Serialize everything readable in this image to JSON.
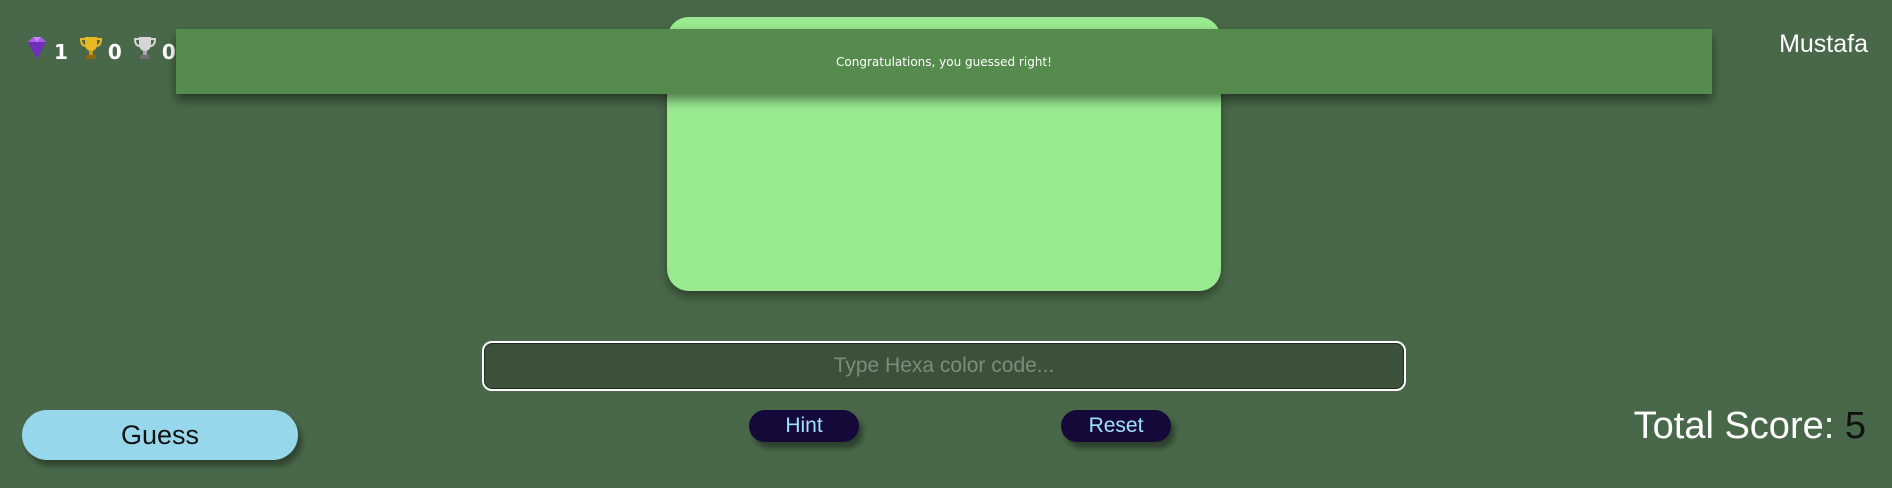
{
  "stats": {
    "gems": "1",
    "gold_trophies": "0",
    "silver_trophies": "0"
  },
  "user": {
    "name": "Mustafa"
  },
  "toast": {
    "message": "Congratulations, you guessed right!"
  },
  "color_card": {
    "color": "#99e990"
  },
  "input": {
    "placeholder": "Type Hexa color code...",
    "value": ""
  },
  "buttons": {
    "guess": "Guess",
    "hint": "Hint",
    "reset": "Reset"
  },
  "score": {
    "label": "Total Score:",
    "value": "5"
  },
  "colors": {
    "background": "#496849",
    "toast": "#558b4c",
    "guess_button": "#96d7eb",
    "small_button": "#15093a"
  },
  "icons": [
    "gem-icon",
    "gold-trophy-icon",
    "silver-trophy-icon"
  ]
}
